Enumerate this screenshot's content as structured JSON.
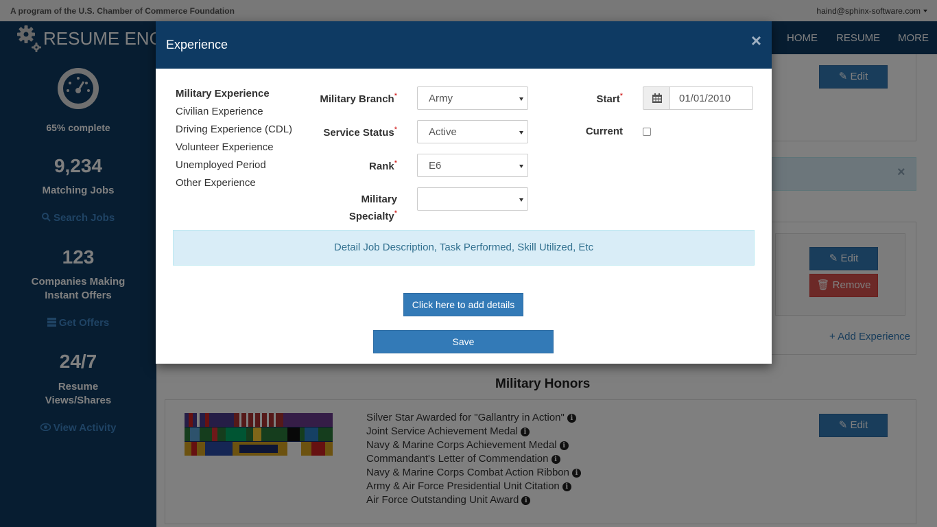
{
  "topbar": {
    "program": "A program of the U.S. Chamber of Commerce Foundation",
    "user": "haind@sphinx-software.com"
  },
  "navbar": {
    "brand": "RESUME ENG",
    "links": [
      "HOME",
      "RESUME",
      "MORE"
    ]
  },
  "sidebar": {
    "completion": "65% complete",
    "matching_count": "9,234",
    "matching_label": "Matching Jobs",
    "search_link": "Search Jobs",
    "companies_count": "123",
    "companies_label_1": "Companies Making",
    "companies_label_2": "Instant Offers",
    "offers_link": "Get Offers",
    "views_count": "24/7",
    "views_label_1": "Resume",
    "views_label_2": "Views/Shares",
    "activity_link": "View Activity"
  },
  "main": {
    "edit_label": "Edit",
    "remove_label": "Remove",
    "add_experience": "+ Add Experience",
    "honors_title": "Military Honors",
    "honors": [
      "Silver Star Awarded for \"Gallantry in Action\"",
      "Joint Service Achievement Medal",
      "Navy & Marine Corps Achievement Medal",
      "Commandant's Letter of Commendation",
      "Navy & Marine Corps Combat Action Ribbon",
      "Army & Air Force Presidential Unit Citation",
      "Air Force Outstanding Unit Award"
    ]
  },
  "modal": {
    "title": "Experience",
    "close": "×",
    "menu": [
      "Military Experience",
      "Civilian Experience",
      "Driving Experience (CDL)",
      "Volunteer Experience",
      "Unemployed Period",
      "Other Experience"
    ],
    "fields": {
      "branch_label": "Military Branch",
      "branch_value": "Army",
      "status_label": "Service Status",
      "status_value": "Active",
      "rank_label": "Rank",
      "rank_value": "E6",
      "specialty_label_1": "Military",
      "specialty_label_2": "Specialty",
      "specialty_value": "",
      "start_label": "Start",
      "start_value": "01/01/2010",
      "current_label": "Current",
      "required_mark": "*"
    },
    "description_hint": "Detail Job Description, Task Performed, Skill Utilized, Etc",
    "add_details_button": "Click here to add details",
    "save_button": "Save"
  },
  "colors": {
    "navy": "#0e3a63",
    "primary": "#337ab7",
    "danger": "#d9534f",
    "info_bg": "#d9edf7"
  }
}
